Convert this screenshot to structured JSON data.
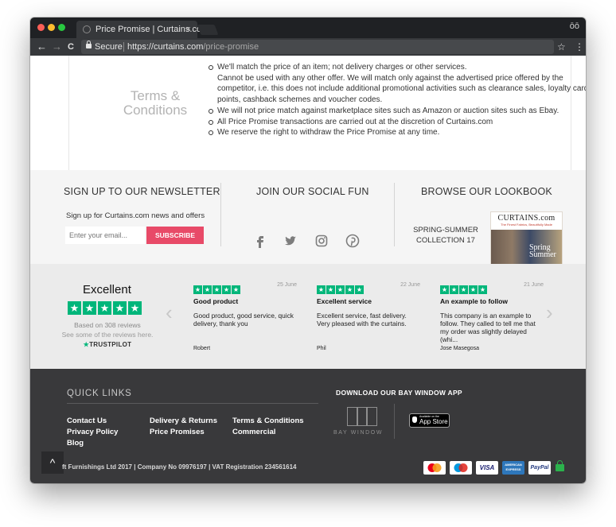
{
  "browser": {
    "tab_title": "Price Promise | Curtains.com",
    "tab_close": "×",
    "incognito_icon": "ōō",
    "nav_back": "←",
    "nav_forward": "→",
    "nav_reload": "C",
    "secure_label": "Secure",
    "url_prefix": "https://curtains.com",
    "url_path": "/price-promise",
    "bookmark_star": "☆",
    "menu_dots": "⋮"
  },
  "terms": {
    "title": "Terms & Conditions",
    "items": [
      {
        "text": "We'll match the price of an item; not delivery charges or other services.",
        "bullet": true
      },
      {
        "text": "Cannot be used with any other offer. We will match only against the advertised price offered by the competitor, i.e. this does not include additional promotional activities such as clearance sales, loyalty card points, cashback schemes and voucher codes.",
        "bullet": false
      },
      {
        "text": "We will not price match against marketplace sites such as Amazon or auction sites such as Ebay.",
        "bullet": true
      },
      {
        "text": "All Price Promise transactions are carried out at the discretion of Curtains.com",
        "bullet": true
      },
      {
        "text": "We reserve the right to withdraw the Price Promise at any time.",
        "bullet": true
      }
    ]
  },
  "newsletter": {
    "heading": "SIGN UP TO OUR NEWSLETTER",
    "text": "Sign up for Curtains.com news and offers",
    "placeholder": "Enter your email...",
    "button": "SUBSCRIBE"
  },
  "social": {
    "heading": "JOIN OUR SOCIAL FUN",
    "icons": [
      "facebook-icon",
      "twitter-icon",
      "instagram-icon",
      "pinterest-icon"
    ]
  },
  "lookbook": {
    "heading": "BROWSE OUR LOOKBOOK",
    "label": "SPRING-SUMMER COLLECTION 17",
    "mag_title": "CURTAINS.com",
    "mag_tagline": "The Finest Fabrics, Beautifully Made",
    "mag_cover": "Spring Summer"
  },
  "trustpilot": {
    "rating": "Excellent",
    "based_on": "Based on 308 reviews",
    "showing": "See some of the reviews here.",
    "brand": "TRUSTPILOT",
    "brand_star": "★",
    "prev": "‹",
    "next": "›",
    "reviews": [
      {
        "date": "25 June",
        "title": "Good product",
        "body": "Good product, good service, quick delivery, thank you",
        "author": "Robert"
      },
      {
        "date": "22 June",
        "title": "Excellent service",
        "body": "Excellent service, fast delivery. Very pleased with the curtains.",
        "author": "Phil"
      },
      {
        "date": "21 June",
        "title": "An example to follow",
        "body": "This company is an example to follow. They called to tell me that my order was slightly delayed (whi...",
        "author": "Jose Masegosa"
      }
    ]
  },
  "footer": {
    "quick_links_heading": "QUICK LINKS",
    "links": [
      "Contact Us",
      "Privacy Policy",
      "Blog",
      "Delivery & Returns",
      "Price Promises",
      "Terms & Conditions",
      "Commercial"
    ],
    "download_heading": "DOWNLOAD OUR BAY WINDOW APP",
    "bay_window": "BAY WINDOW",
    "app_store_small": "Available on the",
    "app_store_big": "App Store",
    "copyright": "ft Furnishings Ltd 2017 | Company No 09976197 | VAT Registration 234561614",
    "back_to_top": "^",
    "payments": [
      "MasterCard",
      "Maestro",
      "VISA",
      "AMERICAN EXPRESS",
      "PayPal"
    ]
  },
  "colors": {
    "trustpilot_green": "#00b67a",
    "subscribe_pink": "#e84a68",
    "footer_bg": "#39393b",
    "newsletter_bg": "#f5f5f5",
    "reviews_bg": "#ebebeb"
  }
}
